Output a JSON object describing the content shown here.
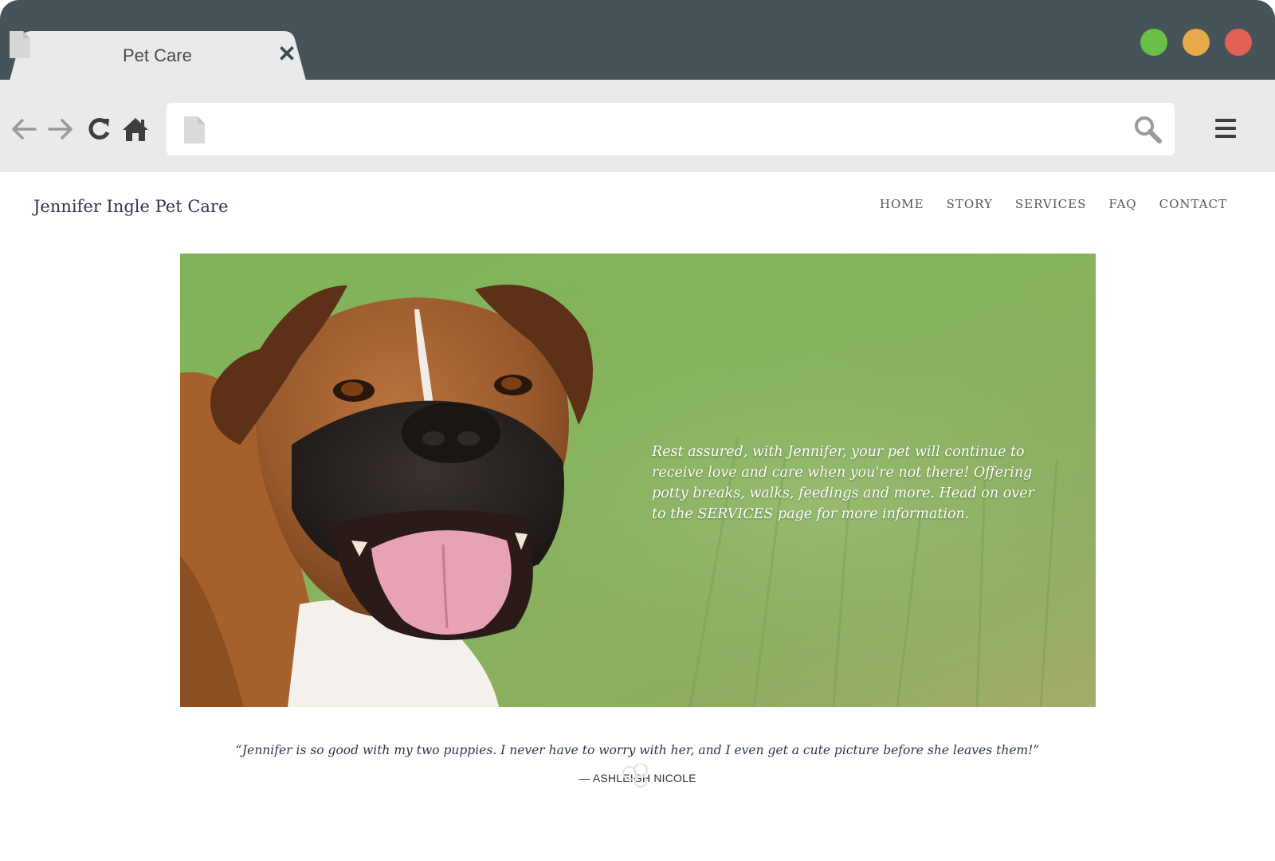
{
  "browser": {
    "tab_title": "Pet Care",
    "tab_close_glyph": "✕",
    "address_value": "",
    "colors": {
      "titlebar": "#465359",
      "toolbar": "#e9eaeb",
      "window_green": "#6abf45",
      "window_yellow": "#e6aa48",
      "window_red": "#e06257"
    }
  },
  "site": {
    "title": "Jennifer Ingle Pet Care",
    "nav": [
      "HOME",
      "STORY",
      "SERVICES",
      "FAQ",
      "CONTACT"
    ],
    "hero_text": "Rest assured, with Jennifer, your pet will continue to receive love and care when you're not there! Offering potty breaks, walks, feedings and more. Head on over to the SERVICES page for more information.",
    "testimonial": "“Jennifer is so good with my two puppies. I never have to worry with her, and I even get a cute picture before she leaves them!”",
    "testimonial_author": "— ASHLEIGH NICOLE",
    "colors": {
      "title": "#2c3750",
      "nav": "#555555"
    }
  }
}
